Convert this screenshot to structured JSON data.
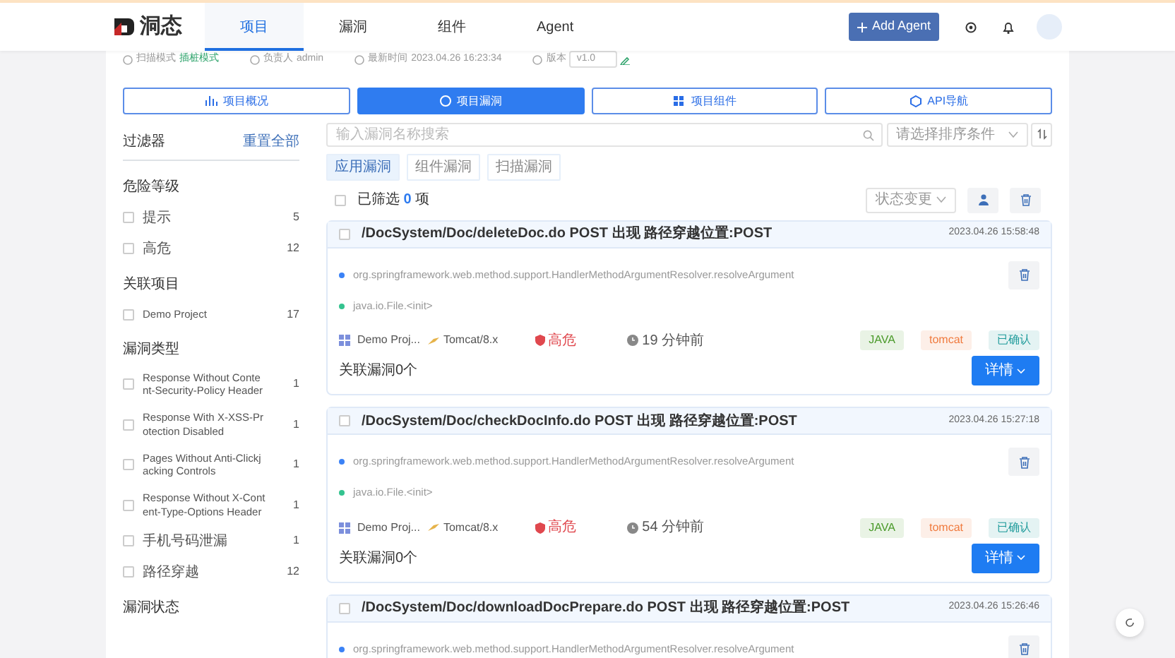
{
  "header": {
    "logo_text": "洞态",
    "nav": [
      {
        "label": "项目",
        "selected": true
      },
      {
        "label": "漏洞",
        "selected": false
      },
      {
        "label": "组件",
        "selected": false
      },
      {
        "label": "Agent",
        "selected": false
      }
    ],
    "add_agent_button": "Add Agent"
  },
  "project_info": [
    {
      "kind": "text",
      "label": "扫描模式",
      "value": "插桩模式"
    },
    {
      "kind": "text",
      "label": "负责人",
      "value": "admin"
    },
    {
      "kind": "text",
      "label": "最新时间",
      "value": "2023.04.26 16:23:34"
    },
    {
      "kind": "select",
      "label": "版本",
      "value": "v1.0"
    }
  ],
  "project_tabs": [
    {
      "label": "项目概况",
      "selected": false
    },
    {
      "label": "项目漏洞",
      "selected": true
    },
    {
      "label": "项目组件",
      "selected": false
    },
    {
      "label": "API导航",
      "selected": false
    }
  ],
  "filters": {
    "title": "过滤器",
    "reset": "重置全部",
    "groups": [
      {
        "title": "危险等级",
        "options": [
          {
            "label": "提示",
            "count": "5",
            "checked": false
          },
          {
            "label": "高危",
            "count": "12",
            "checked": false
          }
        ]
      },
      {
        "title": "关联项目",
        "options": [
          {
            "label": "Demo Project",
            "count": "17",
            "checked": false
          }
        ]
      },
      {
        "title": "漏洞类型",
        "options": [
          {
            "label": "Response Without Content-Security-Policy Header",
            "count": "1",
            "checked": false
          },
          {
            "label": "Response With X-XSS-Protection Disabled",
            "count": "1",
            "checked": false
          },
          {
            "label": "Pages Without Anti-Clickjacking Controls",
            "count": "1",
            "checked": false
          },
          {
            "label": "Response Without X-Content-Type-Options Header",
            "count": "1",
            "checked": false
          },
          {
            "label": "手机号码泄漏",
            "count": "1",
            "checked": false
          },
          {
            "label": "路径穿越",
            "count": "12",
            "checked": false
          }
        ]
      },
      {
        "title": "漏洞状态"
      }
    ]
  },
  "search": {
    "placeholder": "输入漏洞名称搜索"
  },
  "sort": {
    "placeholder": "请选择排序条件"
  },
  "vuln_tabs": [
    {
      "label": "应用漏洞",
      "selected": true
    },
    {
      "label": "组件漏洞",
      "selected": false
    },
    {
      "label": "扫描漏洞",
      "selected": false
    }
  ],
  "selection": {
    "checked": false,
    "summary": "已筛选 **0** 项"
  },
  "status_select": {
    "placeholder": "状态变更"
  },
  "vulns": [
    {
      "checked": false,
      "title": "/DocSystem/Doc/deleteDoc.do POST 出现 路径穿越位置:POST",
      "time": "2023.04.26 15:58:48",
      "trace": [
        {
          "text": "org.springframework.web.method.support.HandlerMethodArgumentResolver.resolveArgument",
          "color": "#3b82f6"
        },
        {
          "text": "java.io.File.<init>",
          "color": "#34c38f"
        }
      ],
      "project": "Demo Proj...",
      "server": "Tomcat/8.x",
      "level": "高危",
      "age": "19 分钟前",
      "tags": [
        {
          "label": "JAVA",
          "color": "#4a9a2a"
        },
        {
          "label": "tomcat",
          "color": "#f07b3f"
        },
        {
          "label": "已确认",
          "color": "#1f9b9b"
        }
      ],
      "related": "关联漏洞0个",
      "detail_button": "详情"
    },
    {
      "checked": false,
      "title": "/DocSystem/Doc/checkDocInfo.do POST 出现 路径穿越位置:POST",
      "time": "2023.04.26 15:27:18",
      "trace": [
        {
          "text": "org.springframework.web.method.support.HandlerMethodArgumentResolver.resolveArgument",
          "color": "#3b82f6"
        },
        {
          "text": "java.io.File.<init>",
          "color": "#34c38f"
        }
      ],
      "project": "Demo Proj...",
      "server": "Tomcat/8.x",
      "level": "高危",
      "age": "54 分钟前",
      "tags": [
        {
          "label": "JAVA",
          "color": "#4a9a2a"
        },
        {
          "label": "tomcat",
          "color": "#f07b3f"
        },
        {
          "label": "已确认",
          "color": "#1f9b9b"
        }
      ],
      "related": "关联漏洞0个",
      "detail_button": "详情"
    },
    {
      "checked": false,
      "title": "/DocSystem/Doc/downloadDocPrepare.do POST 出现 路径穿越位置:POST",
      "time": "2023.04.26 15:26:46",
      "trace": [
        {
          "text": "org.springframework.web.method.support.HandlerMethodArgumentResolver.resolveArgument",
          "color": "#3b82f6"
        }
      ]
    }
  ]
}
